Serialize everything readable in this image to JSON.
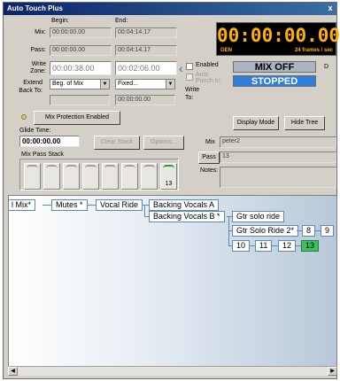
{
  "window": {
    "title": "Auto Touch Plus",
    "close_glyph": "x"
  },
  "range": {
    "begin_header": "Begin:",
    "end_header": "End:",
    "mix_label": "Mix:",
    "mix_begin": "00:00:00.00",
    "mix_end": "00:04:14.17",
    "pass_label": "Pass:",
    "pass_begin": "00:00:00.00",
    "pass_end": "00:04:14.17",
    "write_zone_label": "Write Zone:",
    "write_zone_begin": "00:00:38.00",
    "write_zone_end": "00:02:06.00",
    "extend_back_label": "Extend Back To:",
    "extend_back_select": "Beg. of Mix",
    "extend_back_value": "",
    "write_to_label": "Write To:",
    "write_to_select": "Fixed...",
    "write_to_value": "00:00:00.00"
  },
  "enable": {
    "enabled_label": "Enabled",
    "auto_punch_label": "Auto Punch In"
  },
  "timecode": {
    "value": "00:00:00.00",
    "gen_label": "GEN",
    "fps_label": "24 frames / sec",
    "d_label": "D"
  },
  "status": {
    "mix": "MIX OFF",
    "transport": "STOPPED"
  },
  "mix_protection": {
    "label": "Mix Protection Enabled"
  },
  "buttons": {
    "display_mode": "Display Mode",
    "hide_tree": "Hide Tree",
    "clear_stack": "Clear Stack",
    "options": "Options..."
  },
  "glide": {
    "label": "Glide Time:",
    "value": "00:00:00.00"
  },
  "info": {
    "mix_label": "Mix",
    "mix_value": "peter2",
    "pass_label": "Pass",
    "pass_value": "13",
    "notes_label": "Notes:",
    "notes_value": ""
  },
  "stack": {
    "label": "Mix Pass Stack",
    "top_number": "13"
  },
  "tree": {
    "row1": [
      "l Mix*",
      "Mutes *",
      "Vocal Ride",
      "Backing Vocals A"
    ],
    "row2": [
      "Backing Vocals B *",
      "Gtr solo ride"
    ],
    "row3": [
      "Gtr Solo Ride 2*",
      "8",
      "9"
    ],
    "row4": [
      "10",
      "11",
      "12",
      "13"
    ]
  },
  "colors": {
    "accent_timecode": "#ffb000",
    "status_mix_bg": "#aab4c4",
    "status_transport_bg": "#2f7fd8",
    "active_node": "#3cc060"
  }
}
